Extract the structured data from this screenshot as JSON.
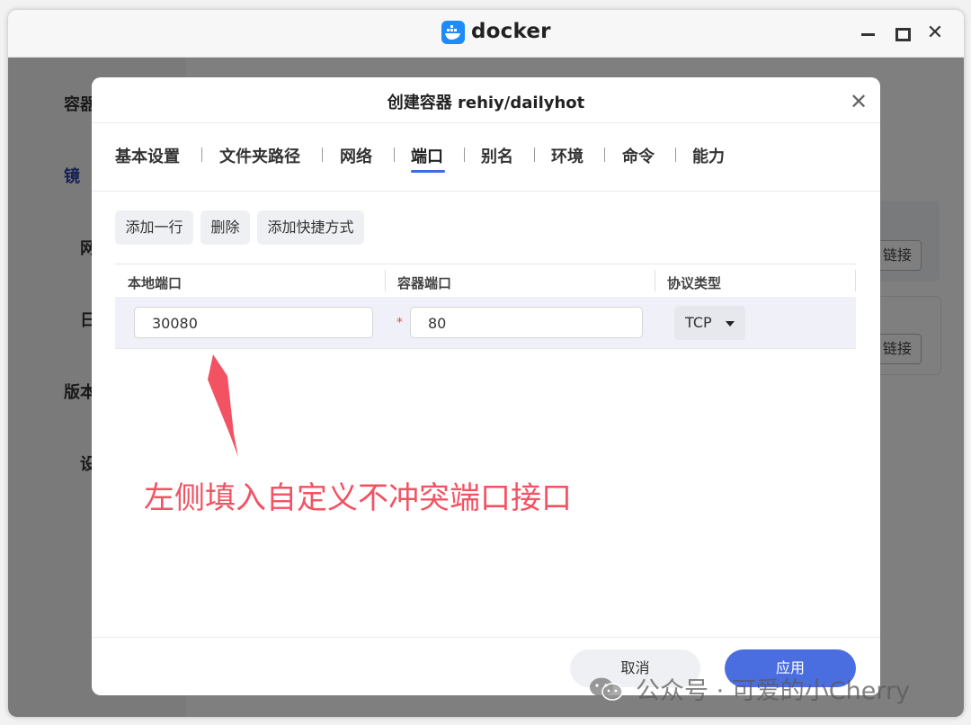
{
  "window": {
    "app_title": "docker"
  },
  "background": {
    "sidebar": [
      "容器",
      "镜",
      "网",
      "日",
      "版本",
      "设"
    ],
    "link_buttons": [
      "链接",
      "链接"
    ]
  },
  "dialog": {
    "title": "创建容器 rehiy/dailyhot",
    "tabs": [
      {
        "label": "基本设置",
        "active": false
      },
      {
        "label": "文件夹路径",
        "active": false
      },
      {
        "label": "网络",
        "active": false
      },
      {
        "label": "端口",
        "active": true
      },
      {
        "label": "别名",
        "active": false
      },
      {
        "label": "环境",
        "active": false
      },
      {
        "label": "命令",
        "active": false
      },
      {
        "label": "能力",
        "active": false
      }
    ],
    "toolbar": {
      "add_row": "添加一行",
      "delete": "删除",
      "add_shortcut": "添加快捷方式"
    },
    "table": {
      "headers": [
        "本地端口",
        "容器端口",
        "协议类型"
      ],
      "rows": [
        {
          "local_port": "30080",
          "container_port": "80",
          "protocol": "TCP"
        }
      ]
    },
    "buttons": {
      "cancel": "取消",
      "apply": "应用"
    }
  },
  "annotation": {
    "text": "左侧填入自定义不冲突端口接口",
    "color": "#f25262"
  },
  "watermark": {
    "text": "公众号 · 可爱的小Cherry"
  },
  "colors": {
    "accent": "#4a6ee0",
    "tab_underline": "#3f6ae5",
    "required": "#e34d4d"
  }
}
